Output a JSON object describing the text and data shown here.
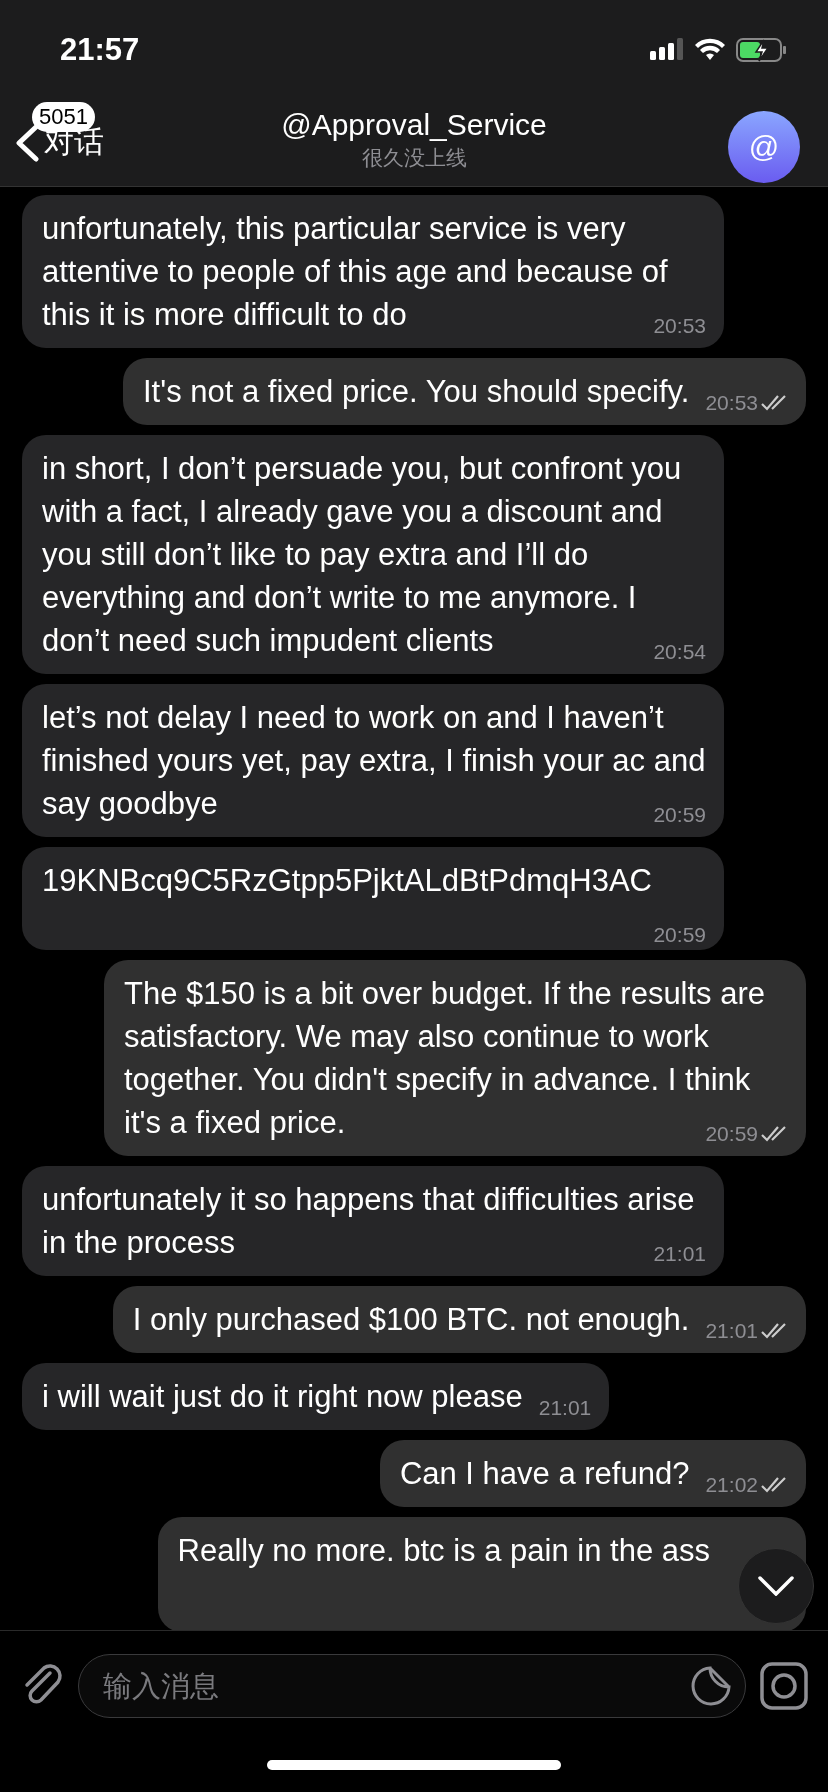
{
  "status_bar": {
    "time": "21:57"
  },
  "header": {
    "back_label": "对话",
    "unread_badge": "5051",
    "title": "@Approval_Service",
    "subtitle": "很久没上线",
    "avatar_text": "@"
  },
  "messages": [
    {
      "outgoing": false,
      "text": "unfortunately, this particular service is very attentive to people of this age and because of this it is more difficult to do",
      "time": "20:53"
    },
    {
      "outgoing": true,
      "read": true,
      "text": "It's not a fixed price. You should specify.",
      "time": "20:53"
    },
    {
      "outgoing": false,
      "text": "in short, I don’t persuade you, but confront you with a fact, I already gave you a discount and you still don’t like to pay extra and I’ll do everything and don’t write to me anymore. I don’t need such impudent clients",
      "time": "20:54"
    },
    {
      "outgoing": false,
      "text": "let’s not delay I need to work on and I haven’t finished yours yet, pay extra, I finish your ac and say goodbye",
      "time": "20:59"
    },
    {
      "outgoing": false,
      "text": "19KNBcq9C5RzGtpp5PjktALdBtPdmqH3AC",
      "time": "20:59"
    },
    {
      "outgoing": true,
      "read": true,
      "text": "The $150 is a bit over budget. If the results are satisfactory. We may also continue to work together. You didn't specify in advance. I think it's a fixed price.",
      "time": "20:59"
    },
    {
      "outgoing": false,
      "text": "unfortunately it so happens that difficulties arise in the process",
      "time": "21:01"
    },
    {
      "outgoing": true,
      "read": true,
      "text": "I only purchased $100 BTC. not enough.",
      "time": "21:01"
    },
    {
      "outgoing": false,
      "text": "i will wait just do it right now please",
      "time": "21:01"
    },
    {
      "outgoing": true,
      "read": true,
      "text": "Can I have a refund?",
      "time": "21:02"
    },
    {
      "outgoing": true,
      "text": "Really no more. btc is a pain in the ass"
    }
  ],
  "composer": {
    "placeholder": "输入消息"
  }
}
